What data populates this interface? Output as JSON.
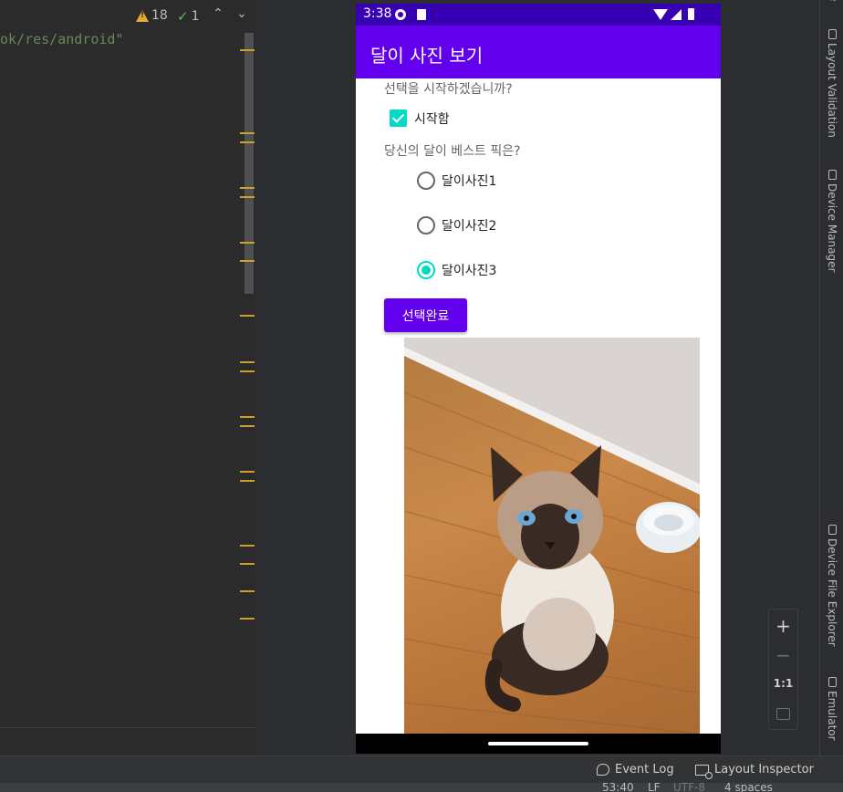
{
  "editor": {
    "warnings_count": "18",
    "typos_count": "1",
    "code_text": "ok/res/android\""
  },
  "phone": {
    "time": "3:38",
    "app_title": "달이 사진 보기",
    "question_start": "선택을 시작하겠습니까?",
    "start_checkbox_label": "시작함",
    "start_checked": true,
    "question_best": "당신의 달이 베스트 픽은?",
    "radio_options": [
      "달이사진1",
      "달이사진2",
      "달이사진3"
    ],
    "selected_option_index": 2,
    "done_button_label": "선택완료"
  },
  "right_tabs": {
    "top_partial": "e",
    "layout_validation": "Layout Validation",
    "device_manager": "Device Manager",
    "device_file_explorer": "Device File Explorer",
    "emulator": "Emulator"
  },
  "zoom": {
    "plus": "+",
    "minus": "−",
    "one_to_one": "1:1"
  },
  "status_bar": {
    "event_log": "Event Log",
    "layout_inspector": "Layout Inspector",
    "line_col": "53:40",
    "line_ending": "LF",
    "encoding": "UTF-8",
    "indent": "4 spaces"
  },
  "colors": {
    "primary": "#6200ee",
    "primary_dark": "#3700b3",
    "accent": "#03dac5"
  }
}
